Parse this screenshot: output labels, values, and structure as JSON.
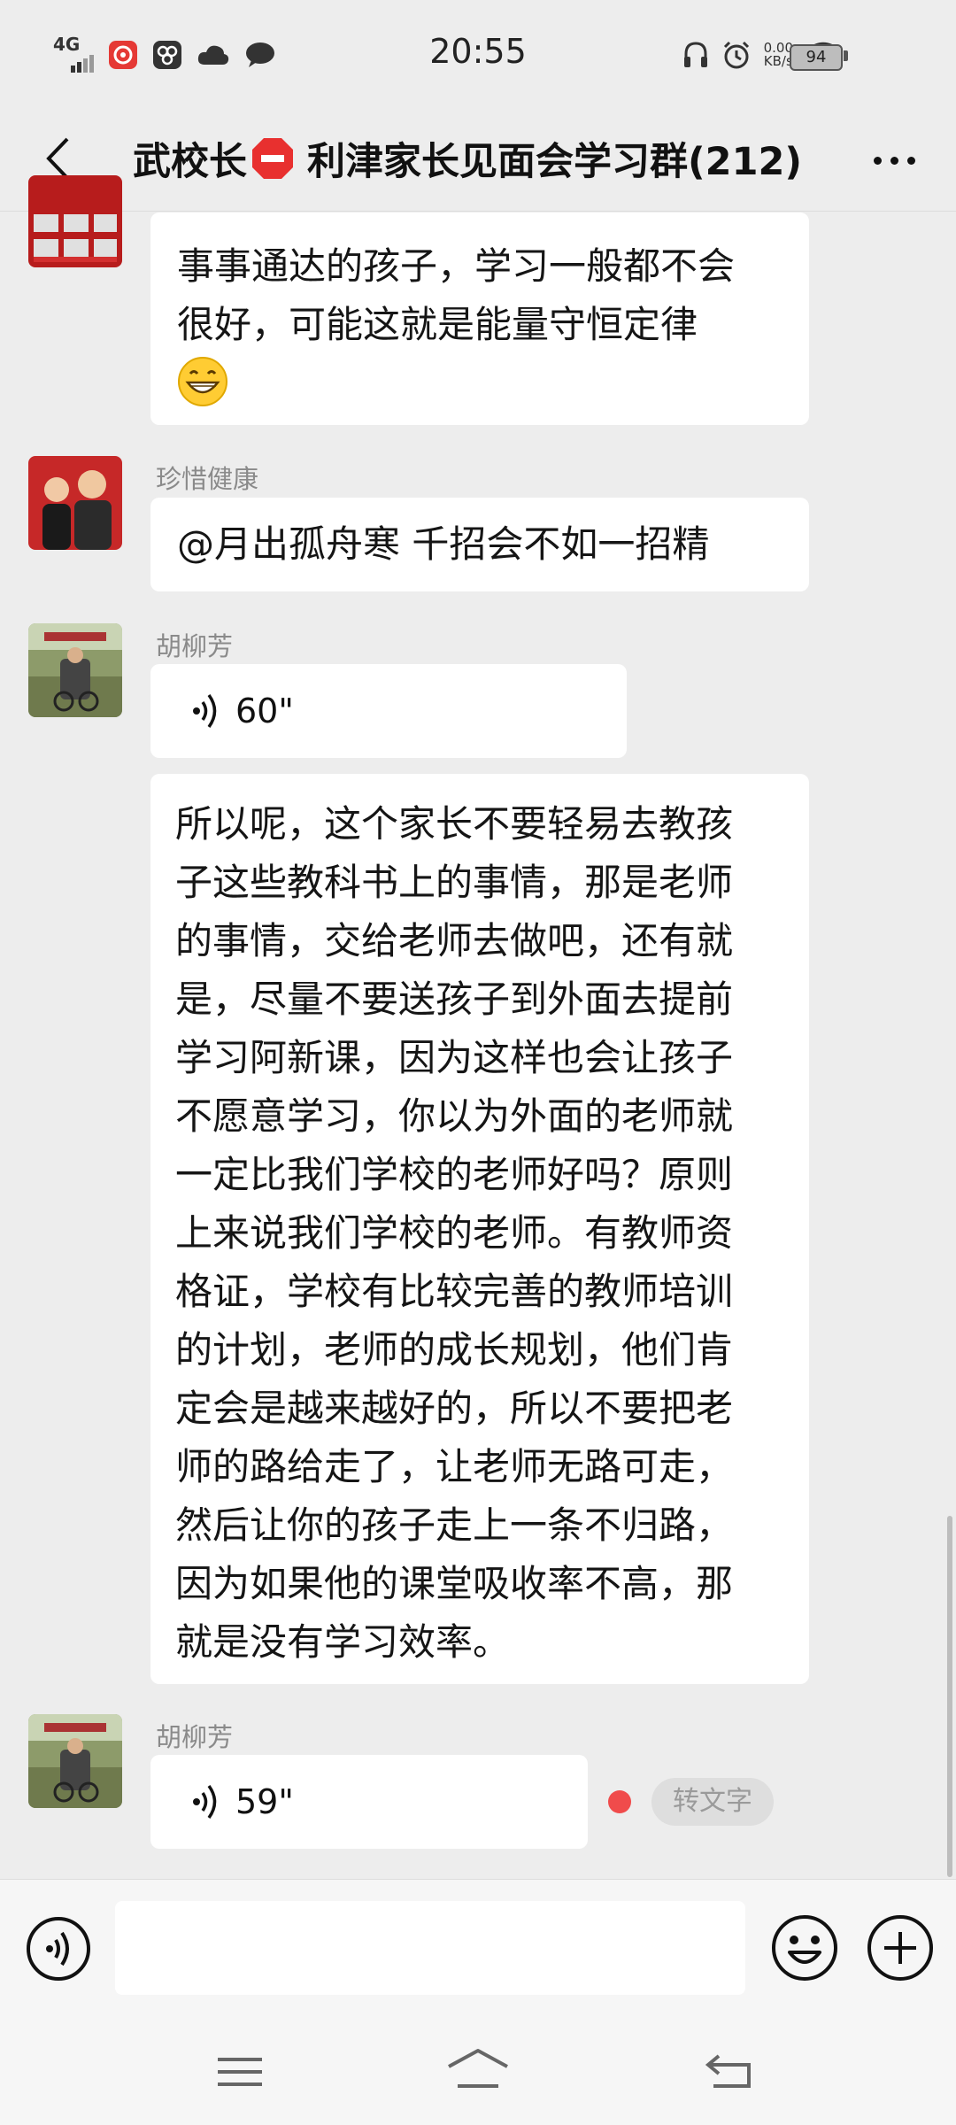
{
  "status_bar": {
    "network": "4G",
    "time": "20:55",
    "speed_value": "0.00",
    "speed_unit": "KB/s",
    "battery": "94"
  },
  "header": {
    "title_prefix": "武校长",
    "title_suffix": "利津家长见面会学习群(212)"
  },
  "messages": {
    "m1": {
      "lines": [
        "事事通达的孩子，学习一般都不会",
        "很好，可能这就是能量守恒定律"
      ]
    },
    "m2": {
      "sender": "珍惜健康",
      "text": "@月出孤舟寒  千招会不如一招精"
    },
    "m3": {
      "sender": "胡柳芳",
      "voice_duration": "60\""
    },
    "m4": {
      "lines": [
        "所以呢，这个家长不要轻易去教孩",
        "子这些教科书上的事情，那是老师",
        "的事情，交给老师去做吧，还有就",
        "是，尽量不要送孩子到外面去提前",
        "学习阿新课，因为这样也会让孩子",
        "不愿意学习，你以为外面的老师就",
        "一定比我们学校的老师好吗？原则",
        "上来说我们学校的老师。有教师资",
        "格证，学校有比较完善的教师培训",
        "的计划，老师的成长规划，他们肯",
        "定会是越来越好的，所以不要把老",
        "师的路给走了，让老师无路可走，",
        "然后让你的孩子走上一条不归路，",
        "因为如果他的课堂吸收率不高，那",
        "就是没有学习效率。"
      ]
    },
    "m5": {
      "sender": "胡柳芳",
      "voice_duration": "59\"",
      "to_text_label": "转文字"
    }
  },
  "input": {
    "placeholder": ""
  },
  "icons": {
    "back": "chevron-left-icon",
    "more": "more-dots-icon",
    "voice_input": "voice-mode-icon",
    "emoji": "emoji-icon",
    "plus": "plus-icon",
    "nav_menu": "menu-icon",
    "nav_home": "home-icon",
    "nav_back": "back-icon"
  },
  "colors": {
    "background": "#ededed",
    "bubble": "#ffffff",
    "unread_dot": "#f04b4b",
    "stop_sign": "#e8302f"
  }
}
